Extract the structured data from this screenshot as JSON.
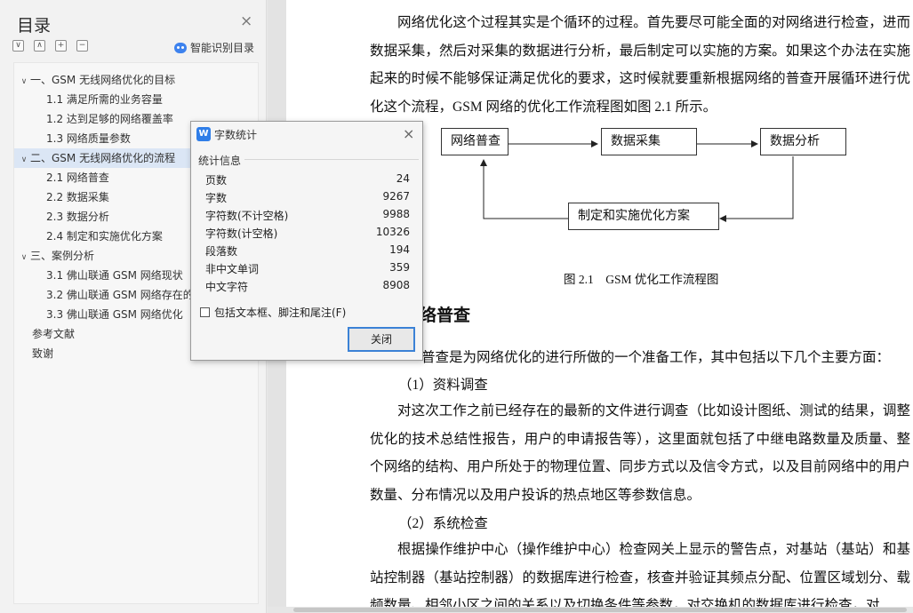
{
  "toc": {
    "title": "目录",
    "close": "×",
    "toolbar": {
      "collapse_all": "∨",
      "expand_all": "∧",
      "plus": "+",
      "minus": "−"
    },
    "smart_label": "智能识别目录",
    "items": [
      {
        "label": "一、GSM 无线网络优化的目标",
        "level": 1,
        "expanded": true
      },
      {
        "label": "1.1 满足所需的业务容量",
        "level": 2
      },
      {
        "label": "1.2 达到足够的网络覆盖率",
        "level": 2
      },
      {
        "label": "1.3 网络质量参数",
        "level": 2
      },
      {
        "label": "二、GSM 无线网络优化的流程",
        "level": 1,
        "expanded": true,
        "selected": true
      },
      {
        "label": "2.1 网络普查",
        "level": 2
      },
      {
        "label": "2.2 数据采集",
        "level": 2
      },
      {
        "label": "2.3 数据分析",
        "level": 2
      },
      {
        "label": "2.4 制定和实施优化方案",
        "level": 2
      },
      {
        "label": "三、案例分析",
        "level": 1,
        "expanded": true
      },
      {
        "label": "3.1 佛山联通 GSM 网络现状",
        "level": 2
      },
      {
        "label": "3.2 佛山联通 GSM 网络存在的",
        "level": 2
      },
      {
        "label": "3.3 佛山联通 GSM 网络优化",
        "level": 2
      },
      {
        "label": "参考文献",
        "level": 1
      },
      {
        "label": "致谢",
        "level": 1
      }
    ]
  },
  "doc": {
    "intro": "网络优化这个过程其实是个循环的过程。首先要尽可能全面的对网络进行检查，进而数据采集，然后对采集的数据进行分析，最后制定可以实施的方案。如果这个办法在实施起来的时候不能够保证满足优化的要求，这时候就要重新根据网络的普查开展循环进行优化这个流程，GSM 网络的优化工作流程图如图 2.1 所示。",
    "flow": {
      "box1": "网络普查",
      "box2": "数据采集",
      "box3": "数据分析",
      "box4": "制定和实施优化方案"
    },
    "caption": "图 2.1　GSM 优化工作流程图",
    "heading": "络普查",
    "p_overview": "普查是为网络优化的进行所做的一个准备工作，其中包括以下几个主要方面：",
    "sub1": "（1）资料调查",
    "p1": "对这次工作之前已经存在的最新的文件进行调查（比如设计图纸、测试的结果，调整优化的技术总结性报告，用户的申请报告等），这里面就包括了中继电路数量及质量、整个网络的结构、用户所处于的物理位置、同步方式以及信令方式，以及目前网络中的用户数量、分布情况以及用户投诉的热点地区等参数信息。",
    "sub2": "（2）系统检查",
    "p2": "根据操作维护中心（操作维护中心）检查网关上显示的警告点，对基站（基站）和基站控制器（基站控制器）的数据库进行检查，核查并验证其频点分配、位置区域划分、载频数量、相邻小区之间的关系以及切换条件等参数，对交换机的数据库进行检查，对"
  },
  "dialog": {
    "title": "字数统计",
    "close": "×",
    "section": "统计信息",
    "stats": [
      {
        "label": "页数",
        "value": "24"
      },
      {
        "label": "字数",
        "value": "9267"
      },
      {
        "label": "字符数(不计空格)",
        "value": "9988"
      },
      {
        "label": "字符数(计空格)",
        "value": "10326"
      },
      {
        "label": "段落数",
        "value": "194"
      },
      {
        "label": "非中文单词",
        "value": "359"
      },
      {
        "label": "中文字符",
        "value": "8908"
      }
    ],
    "checkbox_label": "包括文本框、脚注和尾注(F)",
    "checkbox_checked": false,
    "close_button": "关闭"
  },
  "colors": {
    "accent": "#3b82d6",
    "selection": "#dbe6f5",
    "icon_blue": "#2f7ee8"
  }
}
